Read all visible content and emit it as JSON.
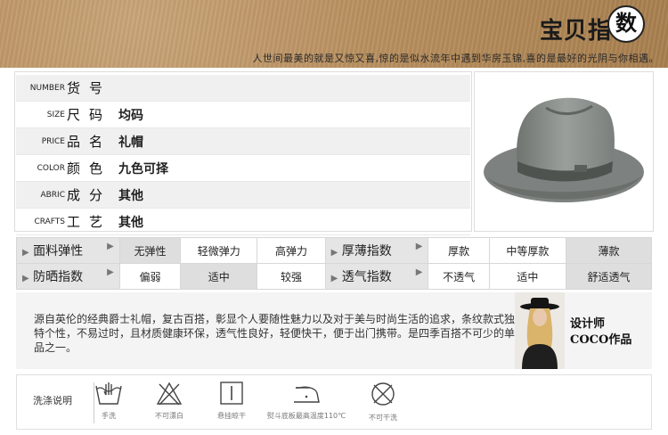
{
  "banner": {
    "title": "宝贝指",
    "title_badge": "数",
    "tagline": "人世间最美的就是又惊又喜,惊的是似水流年中遇到华房玉锦,喜的是最好的光阴与你相遇。"
  },
  "spec": [
    {
      "en": "NUMBER",
      "cn": "货号",
      "value": ""
    },
    {
      "en": "SIZE",
      "cn": "尺码",
      "value": "均码"
    },
    {
      "en": "PRICE",
      "cn": "品名",
      "value": "礼帽"
    },
    {
      "en": "COLOR",
      "cn": "颜色",
      "value": "九色可择"
    },
    {
      "en": "ABRIC",
      "cn": "成分",
      "value": "其他"
    },
    {
      "en": "CRAFTS",
      "cn": "工艺",
      "value": "其他"
    }
  ],
  "product_image": {
    "icon": "fedora-hat-image",
    "color": "#8b908d"
  },
  "attributes": {
    "row1": {
      "group1": {
        "name": "面料弹性",
        "options": [
          "无弹性",
          "轻微弹力",
          "高弹力"
        ],
        "selected": 0
      },
      "group2": {
        "name": "厚薄指数",
        "options": [
          "厚款",
          "中等厚款",
          "薄款"
        ],
        "selected": 2
      }
    },
    "row2": {
      "group1": {
        "name": "防晒指数",
        "options": [
          "偏弱",
          "适中",
          "较强"
        ],
        "selected": 1
      },
      "group2": {
        "name": "透气指数",
        "options": [
          "不透气",
          "适中",
          "舒适透气"
        ],
        "selected": 2
      }
    }
  },
  "description": {
    "text": "源自英伦的经典爵士礼帽，复古百搭，彰显个人要随性魅力以及对于美与时尚生活的追求，条纹款式独特个性，不易过时，且材质健康环保，透气性良好，轻便快干，便于出门携带。是四季百搭不可少的单品之一。",
    "designer_line1": "设计师",
    "designer_line2": "COCO作品"
  },
  "care": {
    "label": "洗涤说明",
    "items": [
      {
        "icon": "hand-wash-icon",
        "caption": "手洗"
      },
      {
        "icon": "no-bleach-icon",
        "caption": "不可漂白"
      },
      {
        "icon": "hang-dry-icon",
        "caption": "悬挂晾干"
      },
      {
        "icon": "iron-icon",
        "caption": "熨斗底板最高温度110℃"
      },
      {
        "icon": "no-dry-clean-icon",
        "caption": "不可干洗"
      }
    ]
  },
  "colors": {
    "banner": "#b9905f",
    "selected_cell": "#dedede",
    "header_cell": "#e5e5e5",
    "hat": "#8b908d"
  }
}
